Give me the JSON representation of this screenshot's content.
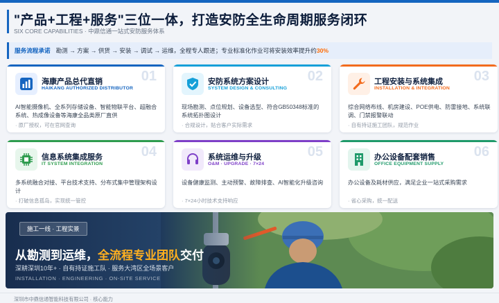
{
  "header": {
    "title": "\"产品+工程+服务\"三位一体，打造安防全生命周期服务闭环",
    "subtitle": "SIX CORE CAPABILITIES · 中鼎信通一站式安防服务体系"
  },
  "flow": {
    "label": "服务流程承诺",
    "text": "勘测 → 方案 → 供货 → 安装 → 调试 → 运维，全程专人跟进；专业标准化作业可将安装效率提升约",
    "highlight": "30%"
  },
  "cards": [
    {
      "title": "海康产品总代直销",
      "en": "HAIKANG AUTHORIZED DISTRIBUTOR",
      "num": "01",
      "desc": "AI智能摄像机、全系列存储设备、智能物联平台、超融合系统、热成像设备等海康全品类原厂直供",
      "note": "· 原厂授权，可在官网查询",
      "icon": "bar-chart-icon",
      "color": "#1565c0",
      "icon_bg": "#e6efff"
    },
    {
      "title": "安防系统方案设计",
      "en": "SYSTEM DESIGN & CONSULTING",
      "num": "02",
      "desc": "现场勘测、点位规划、设备选型、符合GB50348标准的系统拓扑图设计",
      "note": "· 合规设计，贴合客户实际需求",
      "icon": "shield-icon",
      "color": "#16a0d8",
      "icon_bg": "#e3f5fd"
    },
    {
      "title": "工程安装与系统集成",
      "en": "INSTALLATION & INTEGRATION",
      "num": "03",
      "desc": "综合网络布线、机房建设、POE供电、防雷接地、系统联调、门禁报警联动",
      "note": "· 自有持证施工团队，规范作业",
      "icon": "wrench-icon",
      "color": "#f26b1d",
      "icon_bg": "#fff0e6"
    },
    {
      "title": "信息系统集成服务",
      "en": "IT SYSTEM INTEGRATION",
      "num": "04",
      "desc": "多系统融合对接、平台技术支持、分布式集中管理架构设计",
      "note": "· 打破信息孤岛，实现统一管控",
      "icon": "chip-icon",
      "color": "#2e9c4e",
      "icon_bg": "#e7f6ec"
    },
    {
      "title": "系统运维与升级",
      "en": "O&M · UPGRADE · 7×24",
      "num": "05",
      "desc": "设备健康监测、主动预警、故障排查、AI智能化升级咨询",
      "note": "· 7×24小时技术支持响应",
      "icon": "headset-icon",
      "color": "#7e3fc8",
      "icon_bg": "#f1e9fb"
    },
    {
      "title": "办公设备配套销售",
      "en": "OFFICE EQUIPMENT SUPPLY",
      "num": "06",
      "desc": "办公设备及耗材供应，满足企业一站式采购需求",
      "note": "· 省心采购，统一配送",
      "icon": "building-icon",
      "color": "#1f9a6a",
      "icon_bg": "#e3f5ee"
    }
  ],
  "banner": {
    "tag": "施工一线 · 工程实景",
    "title_main": "从勘测到运维，",
    "title_highlight": "全流程专业团队",
    "title_end": "交付",
    "subtitle": "深耕深圳10年+ · 自有持证施工队 · 服务大湾区全场景客户",
    "en": "INSTALLATION · ENGINEERING · ON-SITE SERVICE"
  },
  "footer": {
    "text": "深圳市中鼎信通智能科技有限公司 · 核心能力"
  }
}
